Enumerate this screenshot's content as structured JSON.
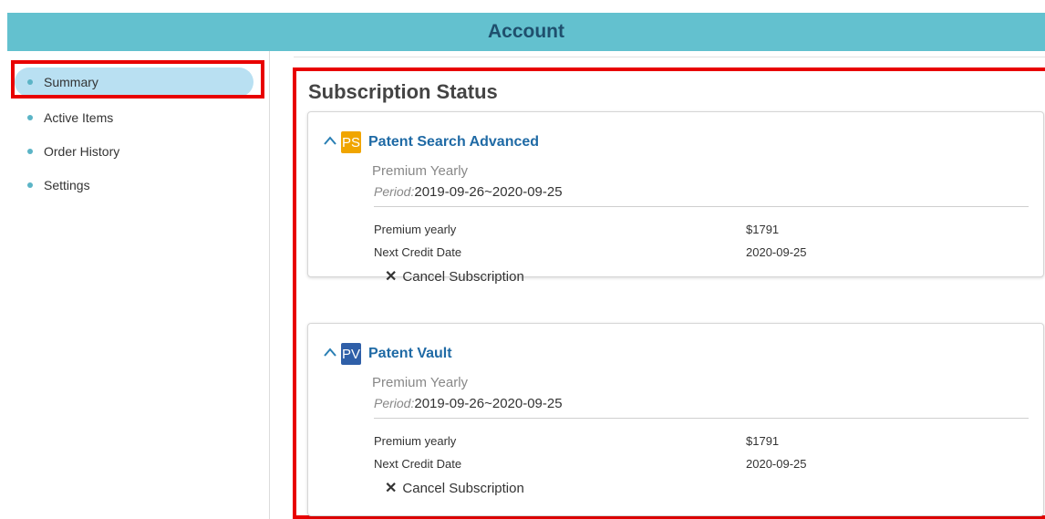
{
  "header": {
    "title": "Account"
  },
  "sidebar": {
    "items": [
      {
        "label": "Summary",
        "active": true
      },
      {
        "label": "Active Items",
        "active": false
      },
      {
        "label": "Order History",
        "active": false
      },
      {
        "label": "Settings",
        "active": false
      }
    ]
  },
  "main": {
    "title": "Subscription Status",
    "cards": [
      {
        "badge": "PS",
        "badge_color": "#f0a500",
        "name": "Patent Search Advanced",
        "plan": "Premium Yearly",
        "period_label": "Period:",
        "period": "2019-09-26~2020-09-25",
        "rows": [
          {
            "label": "Premium yearly",
            "value": "$1791"
          },
          {
            "label": "Next Credit Date",
            "value": "2020-09-25"
          }
        ],
        "cancel_label": "Cancel Subscription"
      },
      {
        "badge": "PV",
        "badge_color": "#2f5fa8",
        "name": "Patent Vault",
        "plan": "Premium Yearly",
        "period_label": "Period:",
        "period": "2019-09-26~2020-09-25",
        "rows": [
          {
            "label": "Premium yearly",
            "value": "$1791"
          },
          {
            "label": "Next Credit Date",
            "value": "2020-09-25"
          }
        ],
        "cancel_label": "Cancel Subscription"
      }
    ]
  }
}
